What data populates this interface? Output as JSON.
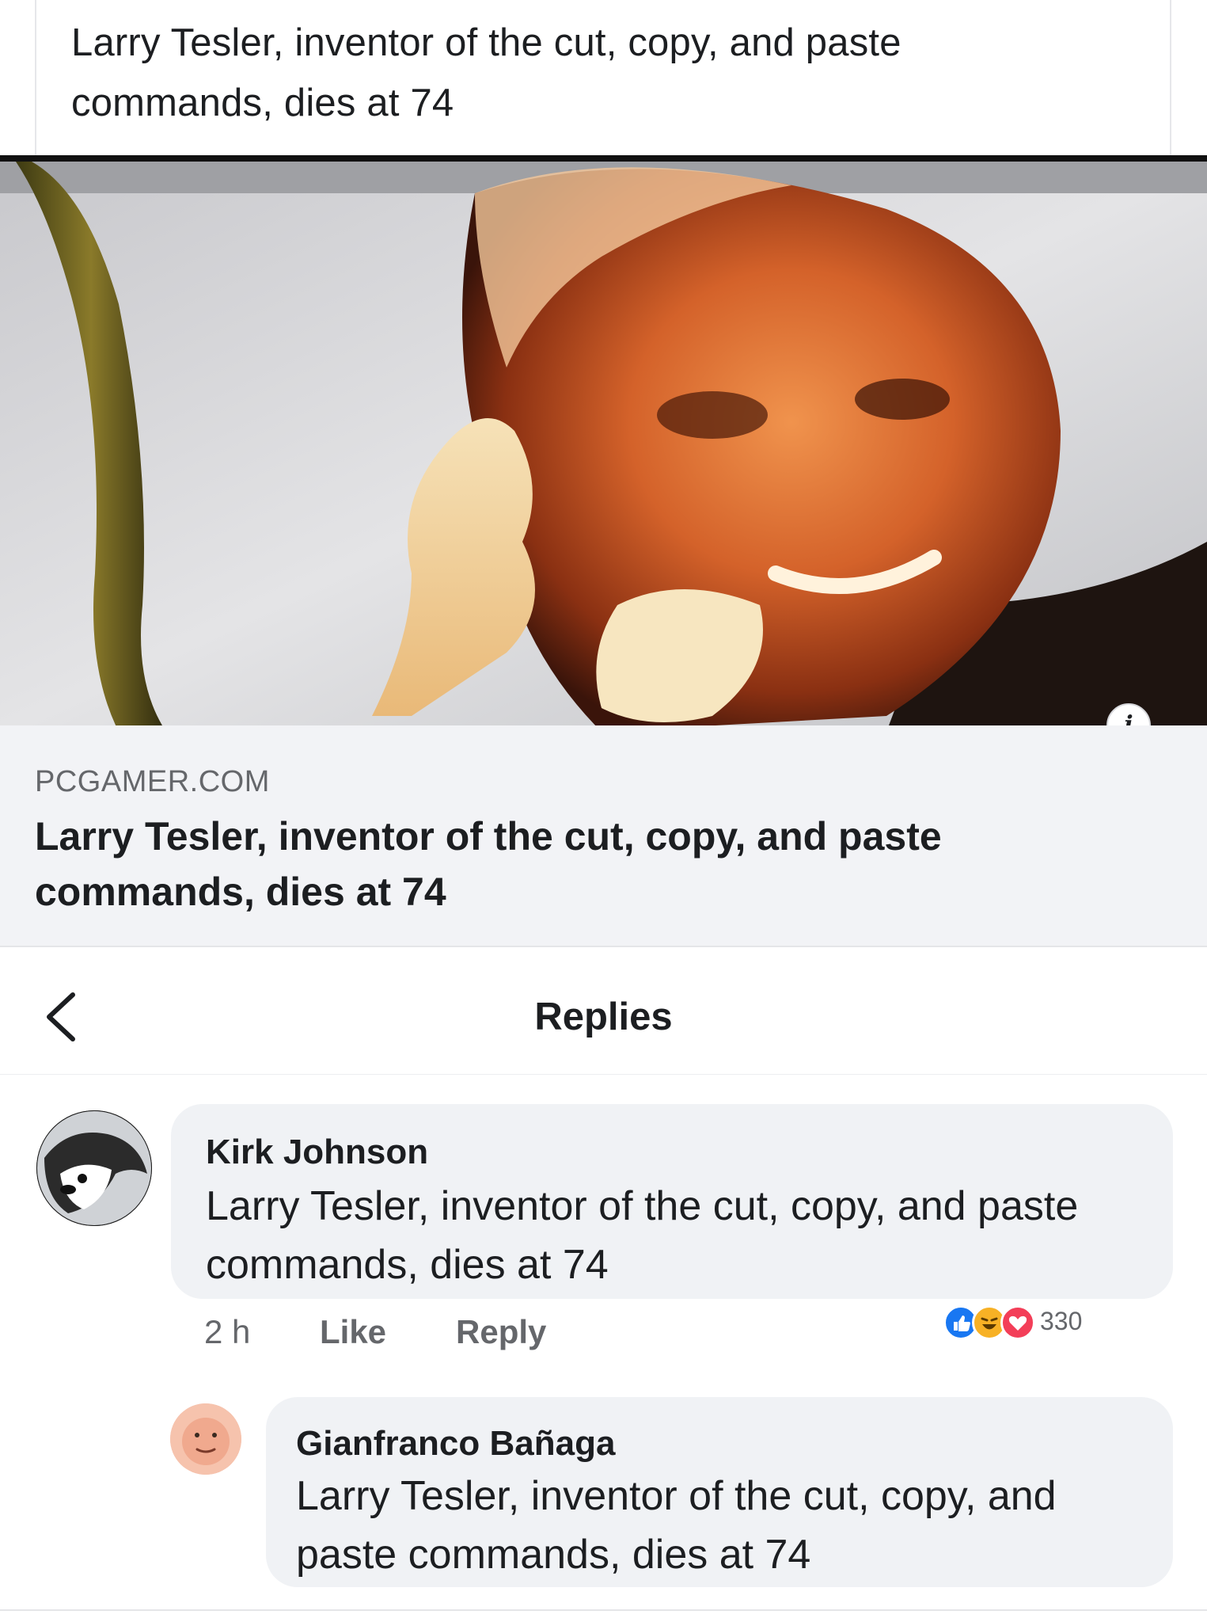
{
  "post": {
    "text": "Larry Tesler, inventor of the cut, copy, and paste commands, dies at 74"
  },
  "link_preview": {
    "image_icon": "portrait-photo",
    "info_icon": "info-icon",
    "info_glyph": "i",
    "domain": "PCGAMER.COM",
    "title": "Larry Tesler, inventor of the cut, copy, and paste commands, dies at 74"
  },
  "replies": {
    "back_icon": "chevron-left-icon",
    "title": "Replies",
    "comments": [
      {
        "author": "Kirk Johnson",
        "text": "Larry Tesler, inventor of the cut, copy, and paste commands, dies at 74",
        "time": "2 h",
        "like_label": "Like",
        "reply_label": "Reply",
        "reactions": [
          "like",
          "haha",
          "love"
        ],
        "reaction_count": "330"
      },
      {
        "author": "Gianfranco Bañaga",
        "text": "Larry Tesler, inventor of the cut, copy, and paste commands, dies at 74"
      }
    ]
  },
  "colors": {
    "like": "#1877f2",
    "haha": "#f7b125",
    "love": "#f33e58",
    "bubble": "#f0f2f5",
    "secondary_text": "#65676b"
  }
}
